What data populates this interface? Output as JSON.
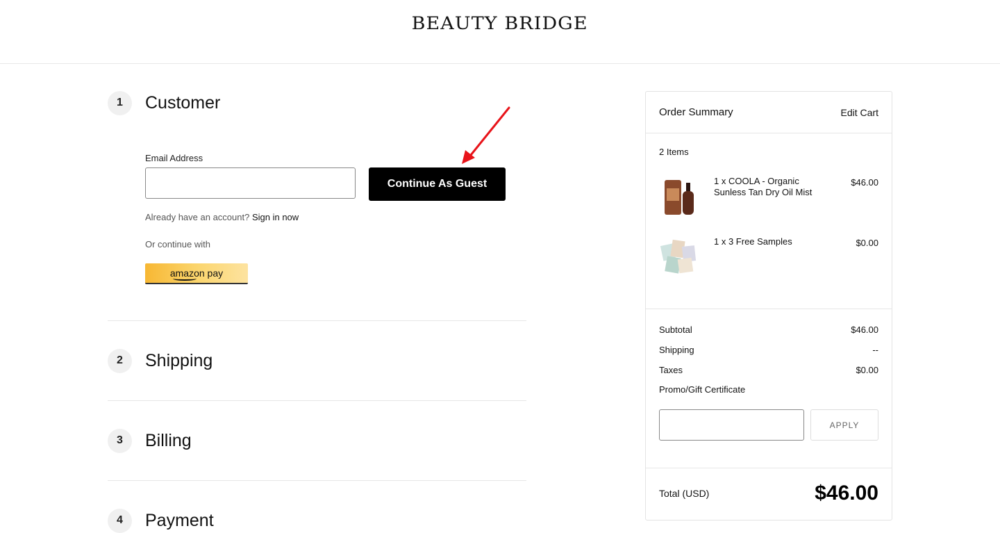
{
  "brand": {
    "logo_text": "BEAUTY BRIDGE"
  },
  "checkout": {
    "steps": [
      {
        "number": "1",
        "title": "Customer"
      },
      {
        "number": "2",
        "title": "Shipping"
      },
      {
        "number": "3",
        "title": "Billing"
      },
      {
        "number": "4",
        "title": "Payment"
      }
    ],
    "customer": {
      "email_label": "Email Address",
      "email_value": "",
      "guest_button": "Continue As Guest",
      "account_prompt": "Already have an account?",
      "signin_link": "Sign in now",
      "or_continue": "Or continue with",
      "amazon_pay_label": "amazon pay"
    }
  },
  "summary": {
    "title": "Order Summary",
    "edit_cart": "Edit Cart",
    "items_count": "2 Items",
    "items": [
      {
        "name": "1 x COOLA - Organic Sunless Tan Dry Oil Mist",
        "price": "$46.00",
        "image": "bottle-product-image"
      },
      {
        "name": "1 x 3 Free Samples",
        "price": "$0.00",
        "image": "samples-product-image"
      }
    ],
    "rows": [
      {
        "label": "Subtotal",
        "value": "$46.00"
      },
      {
        "label": "Shipping",
        "value": "--"
      },
      {
        "label": "Taxes",
        "value": "$0.00"
      }
    ],
    "promo_label": "Promo/Gift Certificate",
    "promo_value": "",
    "apply_label": "APPLY",
    "total_label": "Total (USD)",
    "total_value": "$46.00"
  },
  "colors": {
    "annotation_arrow": "#e8141a",
    "primary_button": "#000000"
  }
}
